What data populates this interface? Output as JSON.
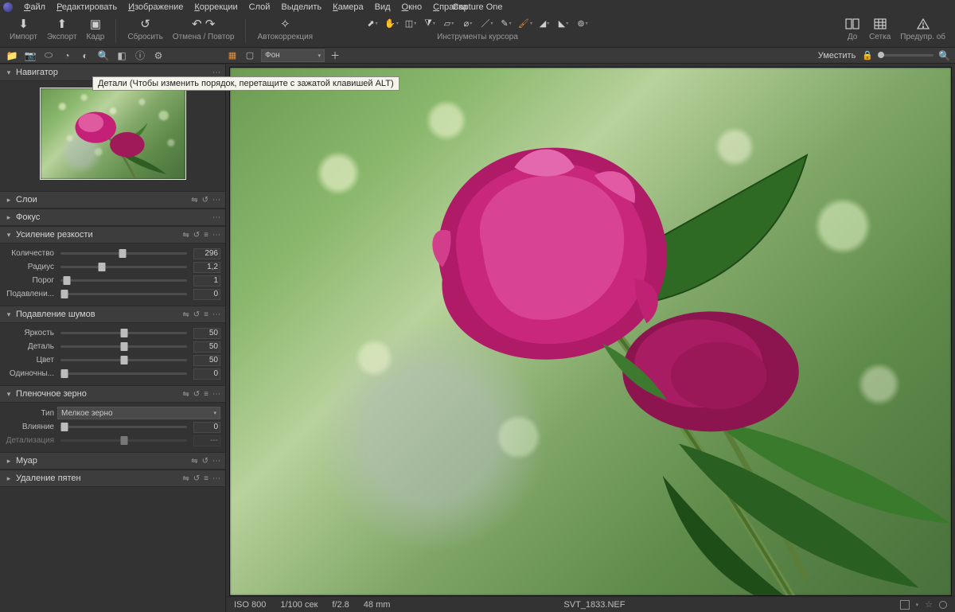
{
  "app": {
    "title": "Capture One"
  },
  "menu": [
    "Файл",
    "Редактировать",
    "Изображение",
    "Коррекции",
    "Слой",
    "Выделить",
    "Камера",
    "Вид",
    "Окно",
    "Справка"
  ],
  "toolbar": {
    "import": "Импорт",
    "export": "Экспорт",
    "frame": "Кадр",
    "reset": "Сбросить",
    "undoRedo": "Отмена / Повтор",
    "auto": "Автокоррекция",
    "cursor_caption": "Инструменты курсора",
    "before": "До",
    "grid": "Сетка",
    "warn": "Предупр. об"
  },
  "tabstrip": {
    "layer_label": "Фон",
    "fit_label": "Уместить"
  },
  "tooltip": "Детали (Чтобы изменить порядок, перетащите с зажатой клавишей ALT)",
  "panels": {
    "navigator": {
      "title": "Навигатор"
    },
    "layers": {
      "title": "Слои"
    },
    "focus": {
      "title": "Фокус"
    },
    "sharpen": {
      "title": "Усиление резкости",
      "rows": [
        {
          "label": "Количество",
          "value": "296",
          "pos": 49
        },
        {
          "label": "Радиус",
          "value": "1,2",
          "pos": 33
        },
        {
          "label": "Порог",
          "value": "1",
          "pos": 5
        },
        {
          "label": "Подавлени...",
          "value": "0",
          "pos": 3
        }
      ]
    },
    "noise": {
      "title": "Подавление шумов",
      "rows": [
        {
          "label": "Яркость",
          "value": "50",
          "pos": 50
        },
        {
          "label": "Деталь",
          "value": "50",
          "pos": 50
        },
        {
          "label": "Цвет",
          "value": "50",
          "pos": 50
        },
        {
          "label": "Одиночны...",
          "value": "0",
          "pos": 3
        }
      ]
    },
    "grain": {
      "title": "Пленочное зерно",
      "type_label": "Тип",
      "type_value": "Мелкое зерно",
      "rows": [
        {
          "label": "Влияние",
          "value": "0",
          "pos": 3
        },
        {
          "label": "Детализация",
          "value": "---",
          "pos": 50,
          "disabled": true
        }
      ]
    },
    "moire": {
      "title": "Муар"
    },
    "spot": {
      "title": "Удаление пятен"
    }
  },
  "footer": {
    "iso": "ISO 800",
    "shutter": "1/100 сек",
    "aperture": "f/2.8",
    "focal": "48 mm",
    "filename": "SVT_1833.NEF"
  }
}
